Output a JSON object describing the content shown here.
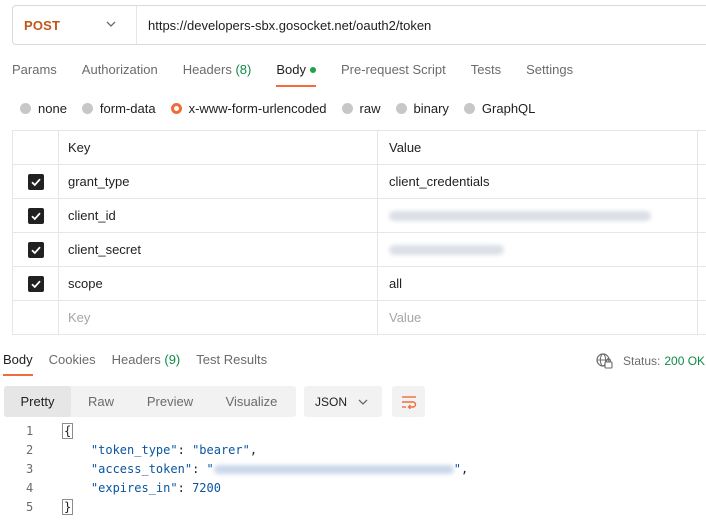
{
  "request": {
    "method": "POST",
    "url": "https://developers-sbx.gosocket.net/oauth2/token"
  },
  "request_tabs": [
    {
      "label": "Params"
    },
    {
      "label": "Authorization"
    },
    {
      "label": "Headers",
      "count": "(8)"
    },
    {
      "label": "Body"
    },
    {
      "label": "Pre-request Script"
    },
    {
      "label": "Tests"
    },
    {
      "label": "Settings"
    }
  ],
  "body_types": [
    "none",
    "form-data",
    "x-www-form-urlencoded",
    "raw",
    "binary",
    "GraphQL"
  ],
  "body_type_selected": "x-www-form-urlencoded",
  "table": {
    "headers": {
      "key": "Key",
      "value": "Value"
    },
    "rows": [
      {
        "key": "grant_type",
        "value": "client_credentials",
        "checked": true
      },
      {
        "key": "client_id",
        "value": "",
        "value_hidden": true,
        "checked": true
      },
      {
        "key": "client_secret",
        "value": "",
        "value_hidden": true,
        "checked": true
      },
      {
        "key": "scope",
        "value": "all",
        "checked": true
      }
    ],
    "placeholder": {
      "key": "Key",
      "value": "Value"
    }
  },
  "response_tabs": [
    {
      "label": "Body"
    },
    {
      "label": "Cookies"
    },
    {
      "label": "Headers",
      "count": "(9)"
    },
    {
      "label": "Test Results"
    }
  ],
  "status": {
    "label": "Status:",
    "value": "200 OK"
  },
  "view_modes": [
    "Pretty",
    "Raw",
    "Preview",
    "Visualize"
  ],
  "format": "JSON",
  "code": {
    "line_numbers": [
      "1",
      "2",
      "3",
      "4",
      "5"
    ],
    "open": "{",
    "close": "}",
    "token_type_key": "\"token_type\"",
    "token_type_val": "\"bearer\"",
    "access_token_key": "\"access_token\"",
    "access_token_open": "\"",
    "access_token_close": "\"",
    "expires_in_key": "\"expires_in\"",
    "expires_in_val": "7200",
    "colon": ": ",
    "comma": ","
  },
  "colors": {
    "accent": "#f26b3a",
    "method": "#c1561a",
    "success": "#0f8a45"
  }
}
